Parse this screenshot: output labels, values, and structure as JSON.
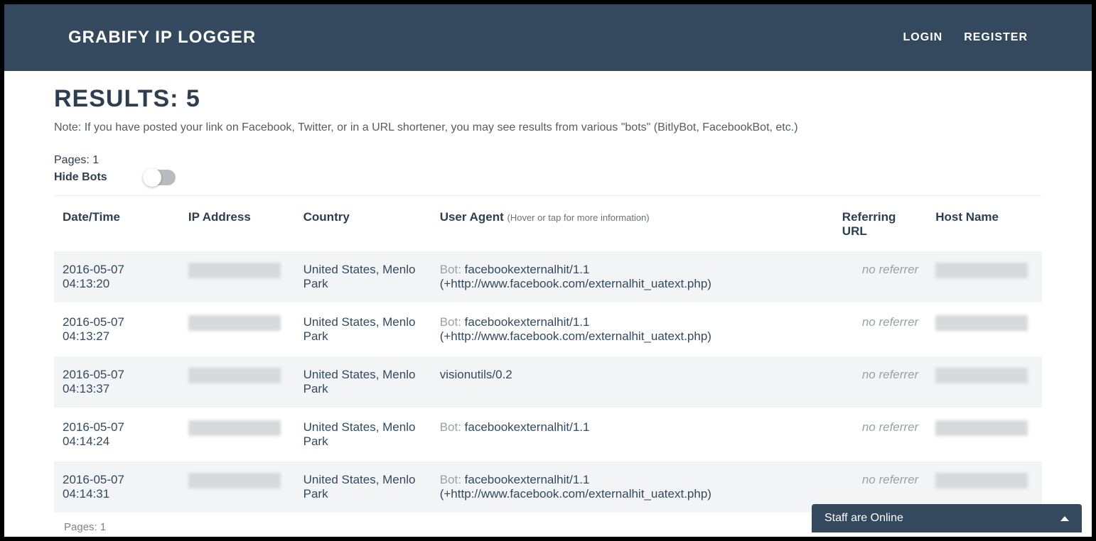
{
  "header": {
    "brand": "GRABIFY IP LOGGER",
    "login": "LOGIN",
    "register": "REGISTER"
  },
  "main": {
    "results_title": "RESULTS: 5",
    "note": "Note: If you have posted your link on Facebook, Twitter, or in a URL shortener, you may see results from various \"bots\" (BitlyBot, FacebookBot, etc.)",
    "pages_label": "Pages: 1",
    "hide_bots_label": "Hide Bots",
    "pages_bottom": "Pages: 1"
  },
  "table": {
    "headers": {
      "date": "Date/Time",
      "ip": "IP Address",
      "country": "Country",
      "ua": "User Agent",
      "ua_hint": "(Hover or tap for more information)",
      "ref": "Referring URL",
      "host": "Host Name"
    },
    "rows": [
      {
        "date": "2016-05-07 04:13:20",
        "country": "United States, Menlo Park",
        "bot_prefix": "Bot: ",
        "ua": "facebookexternalhit/1.1 (+http://www.facebook.com/externalhit_uatext.php)",
        "ref": "no referrer"
      },
      {
        "date": "2016-05-07 04:13:27",
        "country": "United States, Menlo Park",
        "bot_prefix": "Bot: ",
        "ua": "facebookexternalhit/1.1 (+http://www.facebook.com/externalhit_uatext.php)",
        "ref": "no referrer"
      },
      {
        "date": "2016-05-07 04:13:37",
        "country": "United States, Menlo Park",
        "bot_prefix": "",
        "ua": "visionutils/0.2",
        "ref": "no referrer"
      },
      {
        "date": "2016-05-07 04:14:24",
        "country": "United States, Menlo Park",
        "bot_prefix": "Bot: ",
        "ua": "facebookexternalhit/1.1",
        "ref": "no referrer"
      },
      {
        "date": "2016-05-07 04:14:31",
        "country": "United States, Menlo Park",
        "bot_prefix": "Bot: ",
        "ua": "facebookexternalhit/1.1 (+http://www.facebook.com/externalhit_uatext.php)",
        "ref": "no referrer"
      }
    ]
  },
  "staff_bar": {
    "label": "Staff are Online"
  }
}
